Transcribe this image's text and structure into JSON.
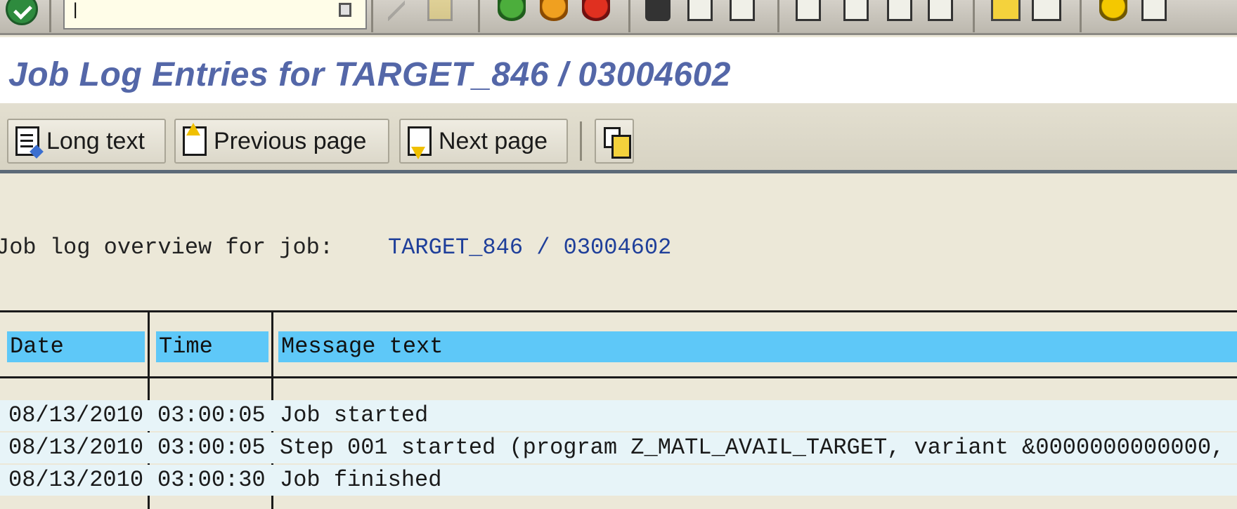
{
  "system_toolbar": {
    "command_field_value": "|",
    "icons": [
      "enter-icon",
      "command-history-icon",
      "back-icon",
      "save-icon",
      "back-green-icon",
      "exit-icon",
      "cancel-icon",
      "print-icon",
      "find-icon",
      "find-next-icon",
      "first-page-icon",
      "previous-page-icon",
      "next-page-icon",
      "last-page-icon",
      "create-session-icon",
      "shortcut-icon",
      "help-icon",
      "layout-menu-icon"
    ]
  },
  "title": "Job Log Entries for TARGET_846 / 03004602",
  "app_toolbar": {
    "long_text": "Long text",
    "previous_page": "Previous page",
    "next_page": "Next page"
  },
  "overview": {
    "label": "Job log overview for job:",
    "value": "TARGET_846 / 03004602"
  },
  "table": {
    "columns": [
      "Date",
      "Time",
      "Message text"
    ],
    "rows": [
      [
        "08/13/2010",
        "03:00:05",
        "Job started"
      ],
      [
        "08/13/2010",
        "03:00:05",
        "Step 001 started (program Z_MATL_AVAIL_TARGET, variant &0000000000000, "
      ],
      [
        "08/13/2010",
        "03:00:30",
        "Job finished"
      ]
    ]
  },
  "colors": {
    "title": "#5467a8",
    "header_cell": "#5ec8f8",
    "row_band": "#e7f4f8",
    "background": "#ece8d8"
  }
}
